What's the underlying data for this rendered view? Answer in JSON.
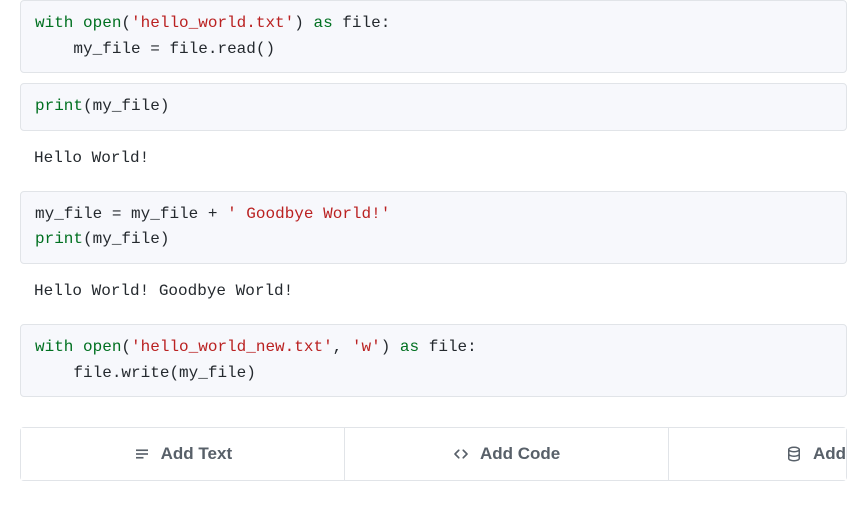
{
  "cells": [
    {
      "type": "code",
      "tokens": [
        {
          "t": "kw",
          "v": "with"
        },
        {
          "t": "sp",
          "v": " "
        },
        {
          "t": "builtin",
          "v": "open"
        },
        {
          "t": "punc",
          "v": "("
        },
        {
          "t": "str",
          "v": "'hello_world.txt'"
        },
        {
          "t": "punc",
          "v": ")"
        },
        {
          "t": "sp",
          "v": " "
        },
        {
          "t": "kw",
          "v": "as"
        },
        {
          "t": "sp",
          "v": " "
        },
        {
          "t": "name",
          "v": "file"
        },
        {
          "t": "punc",
          "v": ":"
        },
        {
          "t": "nl",
          "v": "\n"
        },
        {
          "t": "sp",
          "v": "    "
        },
        {
          "t": "name",
          "v": "my_file"
        },
        {
          "t": "sp",
          "v": " "
        },
        {
          "t": "punc",
          "v": "="
        },
        {
          "t": "sp",
          "v": " "
        },
        {
          "t": "name",
          "v": "file"
        },
        {
          "t": "punc",
          "v": "."
        },
        {
          "t": "name",
          "v": "read"
        },
        {
          "t": "punc",
          "v": "()"
        }
      ]
    },
    {
      "type": "code",
      "tokens": [
        {
          "t": "builtin",
          "v": "print"
        },
        {
          "t": "punc",
          "v": "("
        },
        {
          "t": "name",
          "v": "my_file"
        },
        {
          "t": "punc",
          "v": ")"
        }
      ]
    },
    {
      "type": "output",
      "text": "Hello World!"
    },
    {
      "type": "code",
      "tokens": [
        {
          "t": "name",
          "v": "my_file"
        },
        {
          "t": "sp",
          "v": " "
        },
        {
          "t": "punc",
          "v": "="
        },
        {
          "t": "sp",
          "v": " "
        },
        {
          "t": "name",
          "v": "my_file"
        },
        {
          "t": "sp",
          "v": " "
        },
        {
          "t": "punc",
          "v": "+"
        },
        {
          "t": "sp",
          "v": " "
        },
        {
          "t": "str",
          "v": "' Goodbye World!'"
        },
        {
          "t": "nl",
          "v": "\n"
        },
        {
          "t": "builtin",
          "v": "print"
        },
        {
          "t": "punc",
          "v": "("
        },
        {
          "t": "name",
          "v": "my_file"
        },
        {
          "t": "punc",
          "v": ")"
        }
      ]
    },
    {
      "type": "output",
      "text": "Hello World! Goodbye World!"
    },
    {
      "type": "code",
      "tokens": [
        {
          "t": "kw",
          "v": "with"
        },
        {
          "t": "sp",
          "v": " "
        },
        {
          "t": "builtin",
          "v": "open"
        },
        {
          "t": "punc",
          "v": "("
        },
        {
          "t": "str",
          "v": "'hello_world_new.txt'"
        },
        {
          "t": "punc",
          "v": ","
        },
        {
          "t": "sp",
          "v": " "
        },
        {
          "t": "str",
          "v": "'w'"
        },
        {
          "t": "punc",
          "v": ")"
        },
        {
          "t": "sp",
          "v": " "
        },
        {
          "t": "kw",
          "v": "as"
        },
        {
          "t": "sp",
          "v": " "
        },
        {
          "t": "name",
          "v": "file"
        },
        {
          "t": "punc",
          "v": ":"
        },
        {
          "t": "nl",
          "v": "\n"
        },
        {
          "t": "sp",
          "v": "    "
        },
        {
          "t": "name",
          "v": "file"
        },
        {
          "t": "punc",
          "v": "."
        },
        {
          "t": "name",
          "v": "write"
        },
        {
          "t": "punc",
          "v": "("
        },
        {
          "t": "name",
          "v": "my_file"
        },
        {
          "t": "punc",
          "v": ")"
        }
      ]
    }
  ],
  "toolbar": {
    "add_text_label": "Add Text",
    "add_code_label": "Add Code",
    "add_data_label": "Add"
  }
}
